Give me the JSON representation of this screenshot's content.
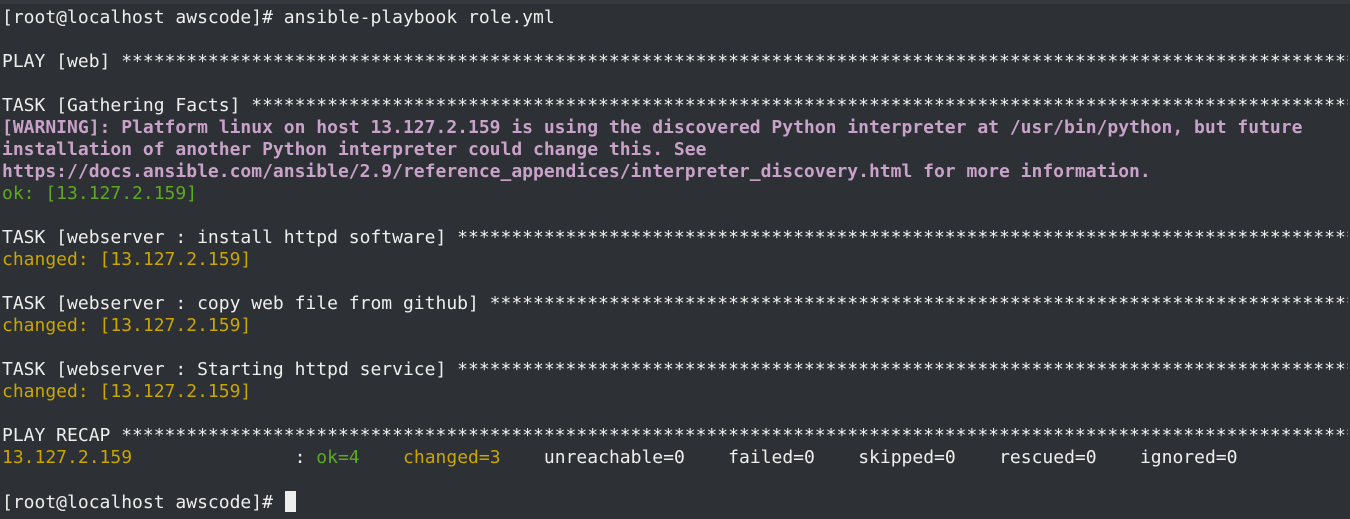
{
  "terminal": {
    "command_prompt": "[root@localhost awscode]# ",
    "command": "ansible-playbook role.yml",
    "play_header": "PLAY [web] ******************************************************************************************************************",
    "gather_header": "TASK [Gathering Facts] ******************************************************************************************************",
    "warning_lines": [
      "[WARNING]: Platform linux on host 13.127.2.159 is using the discovered Python interpreter at /usr/bin/python, but future",
      "installation of another Python interpreter could change this. See",
      "https://docs.ansible.com/ansible/2.9/reference_appendices/interpreter_discovery.html for more information."
    ],
    "gather_result": "ok: [13.127.2.159]",
    "task_install_header": "TASK [webserver : install httpd software] ***********************************************************************************",
    "task_install_result": "changed: [13.127.2.159]",
    "task_copy_header": "TASK [webserver : copy web file from github] *********************************************************************************",
    "task_copy_result": "changed: [13.127.2.159]",
    "task_start_header": "TASK [webserver : Starting httpd service] ***********************************************************************************",
    "task_start_result": "changed: [13.127.2.159]",
    "recap_header": "PLAY RECAP ******************************************************************************************************************",
    "recap": {
      "host": "13.127.2.159               ",
      "sep": ": ",
      "ok": "ok=4",
      "gap1": "    ",
      "changed": "changed=3",
      "gap2": "    ",
      "rest": "unreachable=0    failed=0    skipped=0    rescued=0    ignored=0"
    },
    "final_prompt": "[root@localhost awscode]# "
  },
  "colors": {
    "background": "#2d3034",
    "foreground": "#eeeeec",
    "warning": "#c8a2c8",
    "ok": "#5eaa1f",
    "changed": "#c9a600"
  }
}
